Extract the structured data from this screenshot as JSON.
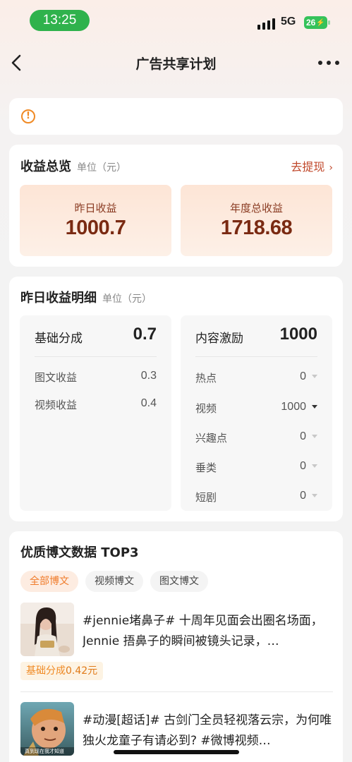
{
  "status_bar": {
    "time": "13:25",
    "network": "5G",
    "battery": "26"
  },
  "nav": {
    "title": "广告共享计划"
  },
  "overview": {
    "title": "收益总览",
    "unit": "单位（元）",
    "withdraw": "去提现",
    "yesterday_label": "昨日收益",
    "yesterday_value": "1000.7",
    "annual_label": "年度总收益",
    "annual_value": "1718.68"
  },
  "detail": {
    "title": "昨日收益明细",
    "unit": "单位（元）",
    "base": {
      "label": "基础分成",
      "value": "0.7",
      "rows": [
        {
          "label": "图文收益",
          "value": "0.3"
        },
        {
          "label": "视频收益",
          "value": "0.4"
        }
      ]
    },
    "incentive": {
      "label": "内容激励",
      "value": "1000",
      "rows": [
        {
          "label": "热点",
          "value": "0"
        },
        {
          "label": "视频",
          "value": "1000"
        },
        {
          "label": "兴趣点",
          "value": "0"
        },
        {
          "label": "垂类",
          "value": "0"
        },
        {
          "label": "短剧",
          "value": "0"
        }
      ]
    }
  },
  "top3": {
    "title": "优质博文数据 TOP3",
    "tabs": [
      "全部博文",
      "视频博文",
      "图文博文"
    ],
    "posts": [
      {
        "text": "#jennie堵鼻子# 十周年见面会出圈名场面，Jennie 捂鼻子的瞬间被镜头记录，…",
        "tag_label": "基础分成",
        "tag_value": "0.42元"
      },
      {
        "text": "#动漫[超话]# 古剑门全员轻视落云宗，为何唯独火龙童子有请必到? #微博视频…",
        "thumb_caption": "真到现在我才知道"
      }
    ]
  },
  "colors": {
    "accent": "#f08a24",
    "withdraw": "#c0472a",
    "status_green": "#2fb24c"
  },
  "icons": [
    "back-icon",
    "more-icon",
    "warning-icon",
    "chevron-right-icon",
    "dropdown-arrow-icon"
  ]
}
